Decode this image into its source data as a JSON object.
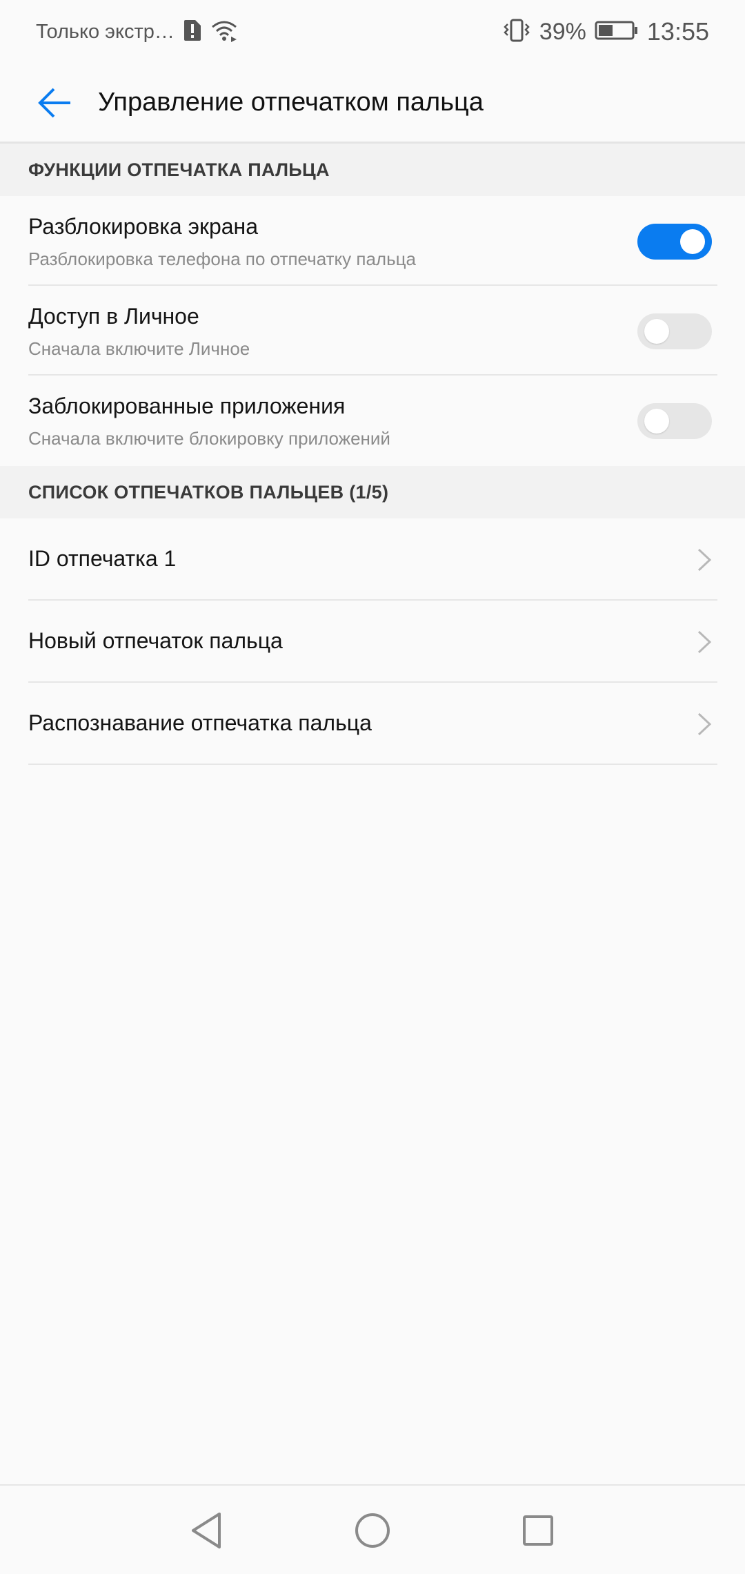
{
  "status_bar": {
    "carrier": "Только экстр…",
    "battery": "39%",
    "time": "13:55",
    "icons": [
      "sim-alert-icon",
      "wifi-icon",
      "vibrate-icon",
      "battery-icon"
    ]
  },
  "app_bar": {
    "title": "Управление отпечатком пальца",
    "back_icon": "arrow-back-icon"
  },
  "sections": {
    "functions": {
      "header": "ФУНКЦИИ ОТПЕЧАТКА ПАЛЬЦА",
      "items": [
        {
          "title": "Разблокировка экрана",
          "subtitle": "Разблокировка телефона по отпечатку пальца",
          "enabled": true
        },
        {
          "title": "Доступ в Личное",
          "subtitle": "Сначала включите Личное",
          "enabled": false
        },
        {
          "title": "Заблокированные приложения",
          "subtitle": "Сначала включите блокировку приложений",
          "enabled": false
        }
      ]
    },
    "fingerprints": {
      "header": "СПИСОК ОТПЕЧАТКОВ ПАЛЬЦЕВ (1/5)",
      "items": [
        {
          "title": "ID отпечатка 1"
        },
        {
          "title": "Новый отпечаток пальца"
        },
        {
          "title": "Распознавание отпечатка пальца"
        }
      ]
    }
  },
  "colors": {
    "accent": "#0a7cf0",
    "switch_off": "#e6e6e6",
    "background": "#fafafa",
    "section_bg": "#f2f2f2"
  },
  "nav_bar": {
    "icons": [
      "nav-back-icon",
      "nav-home-icon",
      "nav-recents-icon"
    ]
  }
}
